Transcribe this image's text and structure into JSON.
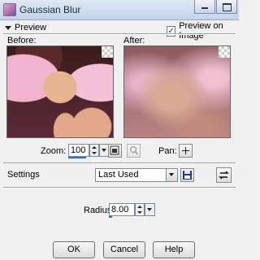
{
  "window": {
    "title": "Gaussian Blur"
  },
  "preview_section": {
    "label": "Preview",
    "preview_on_image_label": "Preview on Image",
    "preview_on_image_checked": true
  },
  "before_label": "Before:",
  "after_label": "After:",
  "zoom": {
    "label": "Zoom:",
    "value": "100"
  },
  "pan": {
    "label": "Pan:"
  },
  "settings": {
    "label": "Settings",
    "selected": "Last Used"
  },
  "radius": {
    "label": "Radius:",
    "value": "8.00"
  },
  "buttons": {
    "ok": "OK",
    "cancel": "Cancel",
    "help": "Help"
  },
  "icons": {
    "app": "paint-program-icon",
    "zoom_fit": "fit-window-icon",
    "zoom_tool": "magnifier-icon",
    "pan": "crosshair-move-icon",
    "save_preset": "floppy-disk-icon",
    "reset": "reset-arrows-icon"
  }
}
